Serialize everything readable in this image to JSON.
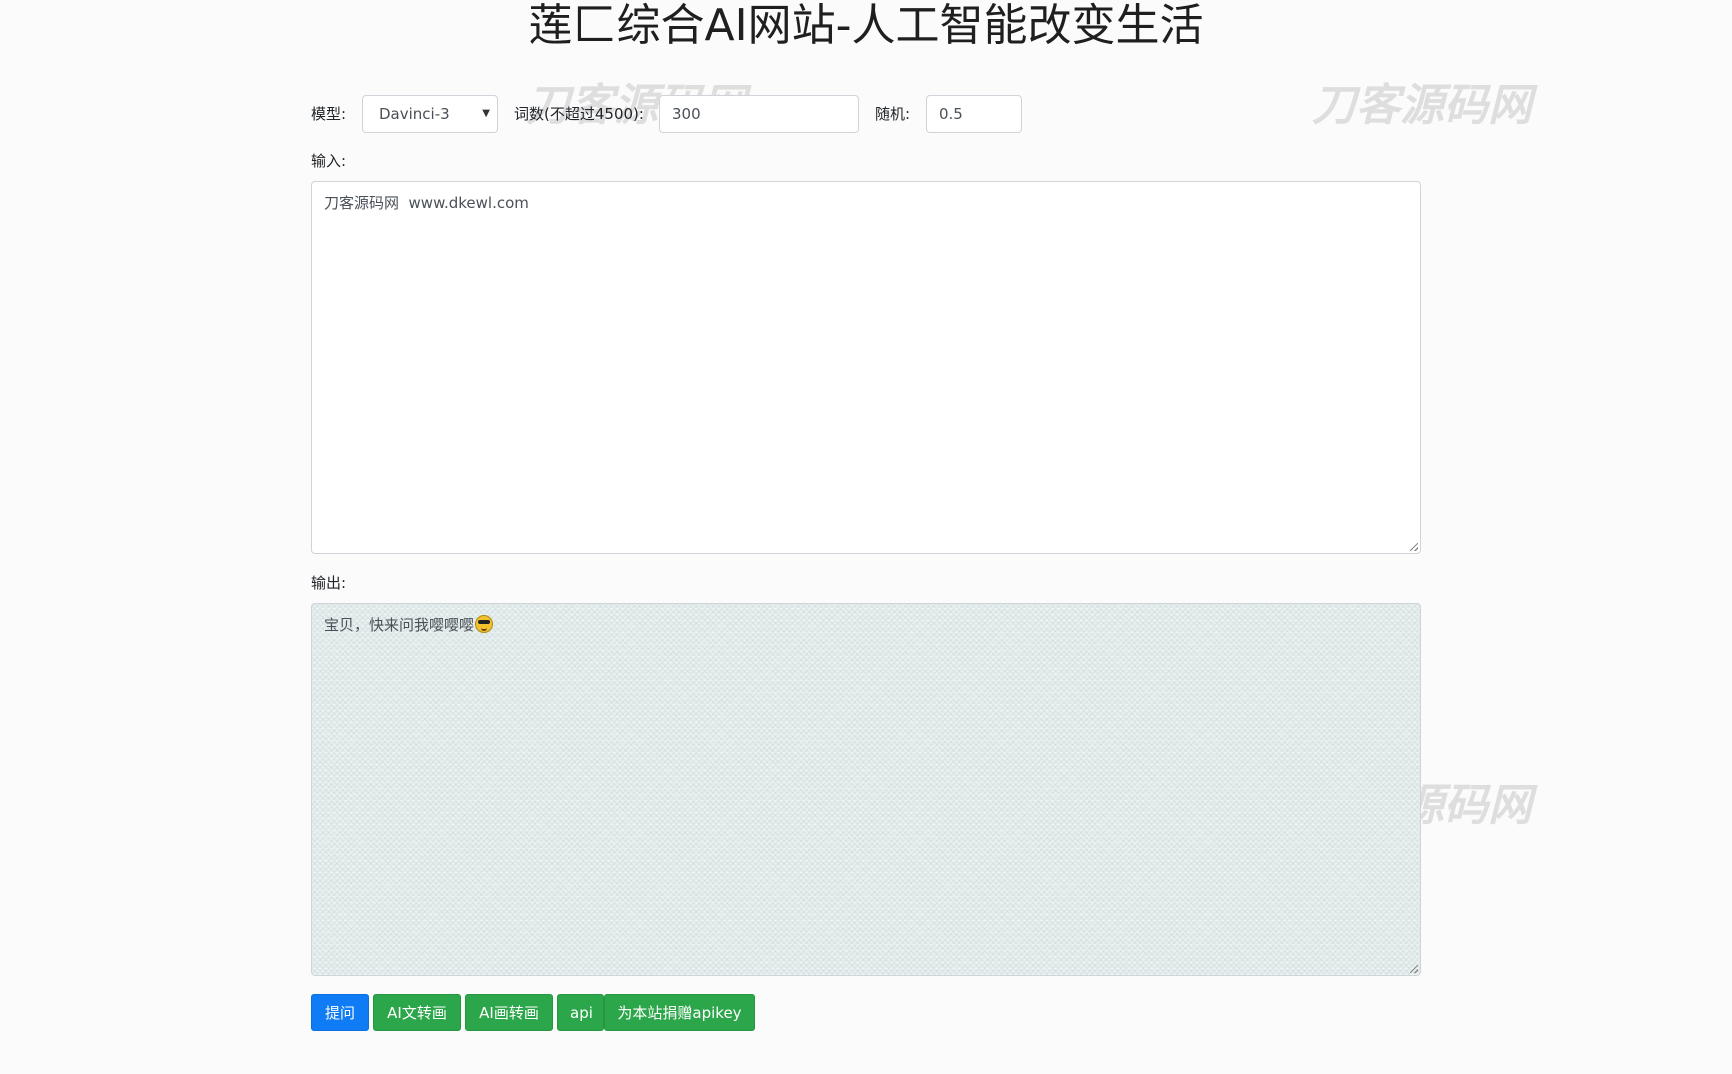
{
  "page": {
    "title": "莲匚综合AI网站-人工智能改变生活"
  },
  "controls": {
    "model_label": "模型:",
    "model_value": "Davinci-3",
    "tokens_label": "词数(不超过4500):",
    "tokens_value": "300",
    "random_label": "随机:",
    "random_value": "0.5"
  },
  "input_section": {
    "label": "输入:",
    "value": "刀客源码网  www.dkewl.com"
  },
  "output_section": {
    "label": "输出:",
    "value": "宝贝，快来问我嘤嘤嘤",
    "emoji_icon": "sunglasses-face-icon"
  },
  "buttons": {
    "ask": "提问",
    "text_to_image": "AI文转画",
    "image_to_image": "AI画转画",
    "api": "api",
    "donate": "为本站捐赠apikey"
  },
  "colors": {
    "primary": "#0f7bf5",
    "success": "#2ca64a"
  },
  "watermark": {
    "text": "刀客源码网"
  }
}
